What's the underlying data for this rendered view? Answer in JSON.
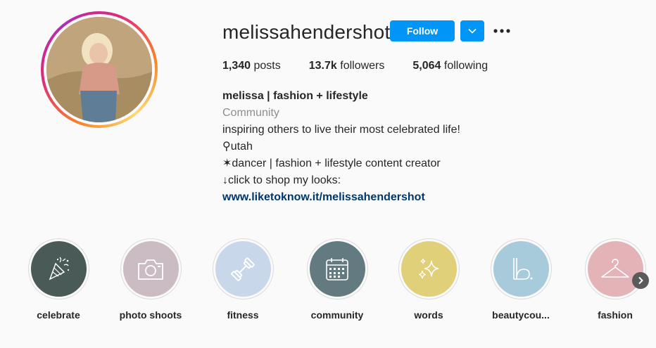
{
  "profile": {
    "username": "melissahendershot",
    "follow_label": "Follow",
    "dropdown_icon": "chevron-down-icon",
    "more_icon": "more-options-icon",
    "avatar_alt": "profile photo"
  },
  "stats": {
    "posts_count": "1,340",
    "posts_label": "posts",
    "followers_count": "13.7k",
    "followers_label": "followers",
    "following_count": "5,064",
    "following_label": "following"
  },
  "bio": {
    "name": "melissa | fashion + lifestyle",
    "category": "Community",
    "line1": "inspiring others to live their most celebrated life!",
    "line2": "⚲utah",
    "line3": "✶dancer | fashion + lifestyle content creator",
    "line4": "↓click to shop my looks:",
    "link": "www.liketoknow.it/melissahendershot"
  },
  "highlights": [
    {
      "label": "celebrate",
      "color": "#4a5a57",
      "icon": "party-popper-icon"
    },
    {
      "label": "photo shoots",
      "color": "#cbbcc3",
      "icon": "camera-icon"
    },
    {
      "label": "fitness",
      "color": "#c8d7ea",
      "icon": "dumbbell-icon"
    },
    {
      "label": "community",
      "color": "#627a80",
      "icon": "calendar-icon"
    },
    {
      "label": "words",
      "color": "#e0d07a",
      "icon": "sparkles-icon"
    },
    {
      "label": "beautycou...",
      "color": "#a8cbdc",
      "icon": "letter-b-icon"
    },
    {
      "label": "fashion",
      "color": "#e3b3b8",
      "icon": "hanger-icon"
    }
  ],
  "next_icon": "chevron-right-icon"
}
